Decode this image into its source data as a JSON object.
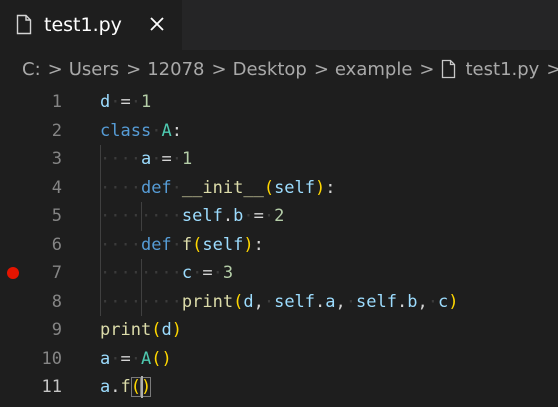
{
  "tab": {
    "label": "test1.py",
    "close_glyph": "✕",
    "icon": "file-icon"
  },
  "breadcrumb": {
    "items": [
      "C:",
      "Users",
      "12078",
      "Desktop",
      "example"
    ],
    "file": "test1.py",
    "trailing": "...",
    "separator": "›"
  },
  "editor": {
    "active_line": 11,
    "breakpoints": [
      7
    ],
    "lines": [
      {
        "n": "1",
        "tokens": [
          [
            "var",
            "d"
          ],
          [
            "ws",
            "·"
          ],
          [
            "punc",
            "="
          ],
          [
            "ws",
            "·"
          ],
          [
            "num",
            "1"
          ]
        ]
      },
      {
        "n": "2",
        "tokens": [
          [
            "kw",
            "class"
          ],
          [
            "ws",
            "·"
          ],
          [
            "cls",
            "A"
          ],
          [
            "punc",
            ":"
          ]
        ]
      },
      {
        "n": "3",
        "tokens": [
          [
            "ws",
            "····"
          ],
          [
            "var",
            "a"
          ],
          [
            "ws",
            "·"
          ],
          [
            "punc",
            "="
          ],
          [
            "ws",
            "·"
          ],
          [
            "num",
            "1"
          ]
        ]
      },
      {
        "n": "4",
        "tokens": [
          [
            "ws",
            "····"
          ],
          [
            "kw",
            "def"
          ],
          [
            "ws",
            "·"
          ],
          [
            "fn",
            "__init__"
          ],
          [
            "br1",
            "("
          ],
          [
            "self",
            "self"
          ],
          [
            "br1",
            ")"
          ],
          [
            "punc",
            ":"
          ]
        ]
      },
      {
        "n": "5",
        "tokens": [
          [
            "ws",
            "········"
          ],
          [
            "self",
            "self"
          ],
          [
            "punc",
            "."
          ],
          [
            "var",
            "b"
          ],
          [
            "ws",
            "·"
          ],
          [
            "punc",
            "="
          ],
          [
            "ws",
            "·"
          ],
          [
            "num",
            "2"
          ]
        ]
      },
      {
        "n": "6",
        "tokens": [
          [
            "ws",
            "····"
          ],
          [
            "kw",
            "def"
          ],
          [
            "ws",
            "·"
          ],
          [
            "fn",
            "f"
          ],
          [
            "br1",
            "("
          ],
          [
            "self",
            "self"
          ],
          [
            "br1",
            ")"
          ],
          [
            "punc",
            ":"
          ]
        ]
      },
      {
        "n": "7",
        "tokens": [
          [
            "ws",
            "········"
          ],
          [
            "var",
            "c"
          ],
          [
            "ws",
            "·"
          ],
          [
            "punc",
            "="
          ],
          [
            "ws",
            "·"
          ],
          [
            "num",
            "3"
          ]
        ]
      },
      {
        "n": "8",
        "tokens": [
          [
            "ws",
            "········"
          ],
          [
            "fn",
            "print"
          ],
          [
            "br1",
            "("
          ],
          [
            "var",
            "d"
          ],
          [
            "punc",
            ","
          ],
          [
            "ws",
            "·"
          ],
          [
            "self",
            "self"
          ],
          [
            "punc",
            "."
          ],
          [
            "var",
            "a"
          ],
          [
            "punc",
            ","
          ],
          [
            "ws",
            "·"
          ],
          [
            "self",
            "self"
          ],
          [
            "punc",
            "."
          ],
          [
            "var",
            "b"
          ],
          [
            "punc",
            ","
          ],
          [
            "ws",
            "·"
          ],
          [
            "var",
            "c"
          ],
          [
            "br1",
            ")"
          ]
        ]
      },
      {
        "n": "9",
        "tokens": [
          [
            "fn",
            "print"
          ],
          [
            "br1",
            "("
          ],
          [
            "var",
            "d"
          ],
          [
            "br1",
            ")"
          ]
        ]
      },
      {
        "n": "10",
        "tokens": [
          [
            "var",
            "a"
          ],
          [
            "ws",
            "·"
          ],
          [
            "punc",
            "="
          ],
          [
            "ws",
            "·"
          ],
          [
            "cls",
            "A"
          ],
          [
            "br1",
            "("
          ],
          [
            "br1",
            ")"
          ]
        ]
      },
      {
        "n": "11",
        "tokens": [
          [
            "var",
            "a"
          ],
          [
            "punc",
            "."
          ],
          [
            "fn",
            "f"
          ],
          [
            "br1m",
            "("
          ],
          [
            "br1",
            "|"
          ],
          [
            "br1m",
            ")"
          ]
        ]
      }
    ]
  },
  "colors": {
    "background": "#1e1e1e",
    "tabbar": "#252526",
    "breakpoint": "#e51400",
    "keyword": "#569cd6",
    "variable": "#9cdcfe",
    "number": "#b5cea8",
    "class": "#4ec9b0",
    "function": "#dcdcaa",
    "bracket": "#ffd700"
  }
}
